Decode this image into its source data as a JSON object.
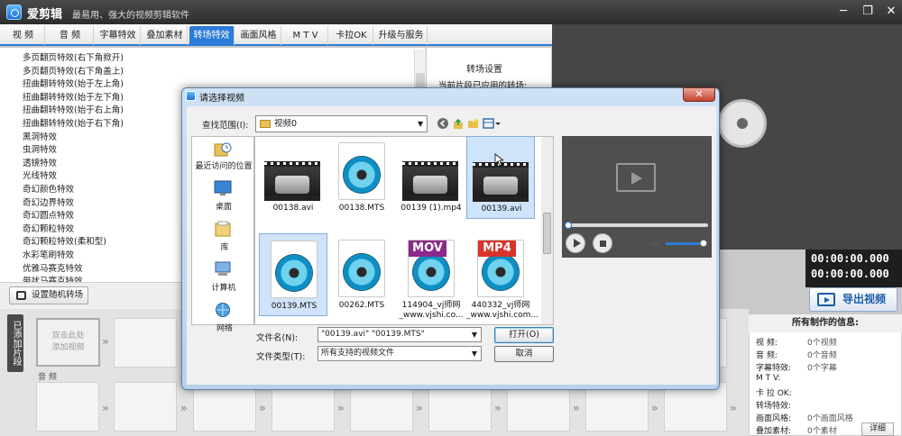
{
  "app": {
    "title": "爱剪辑",
    "slogan": "最易用、强大的视频剪辑软件",
    "window_controls": {
      "minimize": "─",
      "maximize": "❐",
      "close": "✕"
    }
  },
  "tabs": [
    {
      "label": "视  频",
      "active": false
    },
    {
      "label": "音  频",
      "active": false
    },
    {
      "label": "字幕特效",
      "active": false
    },
    {
      "label": "叠加素材",
      "active": false
    },
    {
      "label": "转场特效",
      "active": true
    },
    {
      "label": "画面风格",
      "active": false
    },
    {
      "label": "M T V",
      "active": false
    },
    {
      "label": "卡拉OK",
      "active": false
    },
    {
      "label": "升级与服务",
      "active": false
    }
  ],
  "effects": [
    "多页翻页特效(右下角掀开)",
    "多页翻页特效(右下角盖上)",
    "扭曲翻转特效(始于左上角)",
    "扭曲翻转特效(始于左下角)",
    "扭曲翻转特效(始于右上角)",
    "扭曲翻转特效(始于右下角)",
    "黑洞特效",
    "虫洞特效",
    "透镜特效",
    "光线特效",
    "奇幻颜色特效",
    "奇幻边界特效",
    "奇幻圆点特效",
    "奇幻颗粒特效",
    "奇幻颗粒特效(柔和型)",
    "水彩笔刷特效",
    "优雅马赛克特效",
    "带状马赛克特效"
  ],
  "transition_panel": {
    "title": "转场设置",
    "current_label": "当前片段已应用的转场:"
  },
  "timecodes": [
    "00:00:00.000",
    "00:00:00.000"
  ],
  "export_button": "导出视频",
  "random_transition_button": "设置随机转场",
  "timeline": {
    "sidebar_label": "已添加片段",
    "add_video_text": "双击此处\n添加视频",
    "audio_label": "音 频"
  },
  "info_panel": {
    "header": "所有制作的信息:",
    "rows": [
      {
        "label": "视    频:",
        "value": "0个视频"
      },
      {
        "label": "音    频:",
        "value": "0个音频"
      },
      {
        "label": "字幕特效:",
        "value": "0个字幕"
      },
      {
        "label": "M  T  V:",
        "value": ""
      },
      {
        "label": "卡 拉 OK:",
        "value": ""
      },
      {
        "label": "转场特效:",
        "value": ""
      },
      {
        "label": "画面风格:",
        "value": "0个画面风格"
      },
      {
        "label": "叠加素材:",
        "value": "0个素材"
      }
    ],
    "details_button": "详细"
  },
  "dialog": {
    "title": "请选择视频",
    "close": "✕",
    "lookin_label": "查找范围(I):",
    "lookin_value": "视频0",
    "places": [
      "最近访问的位置",
      "桌面",
      "库",
      "计算机",
      "网络"
    ],
    "files": [
      {
        "name": "00138.avi",
        "kind": "video",
        "badge": "",
        "selected": false
      },
      {
        "name": "00138.MTS",
        "kind": "doc",
        "badge": "",
        "selected": false
      },
      {
        "name": "00139 (1).mp4",
        "kind": "video",
        "badge": "",
        "selected": false
      },
      {
        "name": "00139.avi",
        "kind": "video",
        "badge": "",
        "selected": true
      },
      {
        "name": "00139.MTS",
        "kind": "doc",
        "badge": "",
        "selected": true
      },
      {
        "name": "00262.MTS",
        "kind": "doc",
        "badge": "",
        "selected": false
      },
      {
        "name": "114904_vj师网_www.vjshi.co...",
        "kind": "doc",
        "badge": "MOV",
        "selected": false
      },
      {
        "name": "440332_vj师网_www.vjshi.com...",
        "kind": "doc",
        "badge": "MP4",
        "selected": false
      }
    ],
    "filename_label": "文件名(N):",
    "filename_value": "\"00139.avi\" \"00139.MTS\"",
    "filetype_label": "文件类型(T):",
    "filetype_value": "所有支持的视频文件",
    "open_button": "打开(O)",
    "cancel_button": "取消"
  },
  "colors": {
    "accent": "#2b7bd8",
    "badge_mov": "#8a2a8a",
    "badge_mp4": "#d8342b"
  }
}
